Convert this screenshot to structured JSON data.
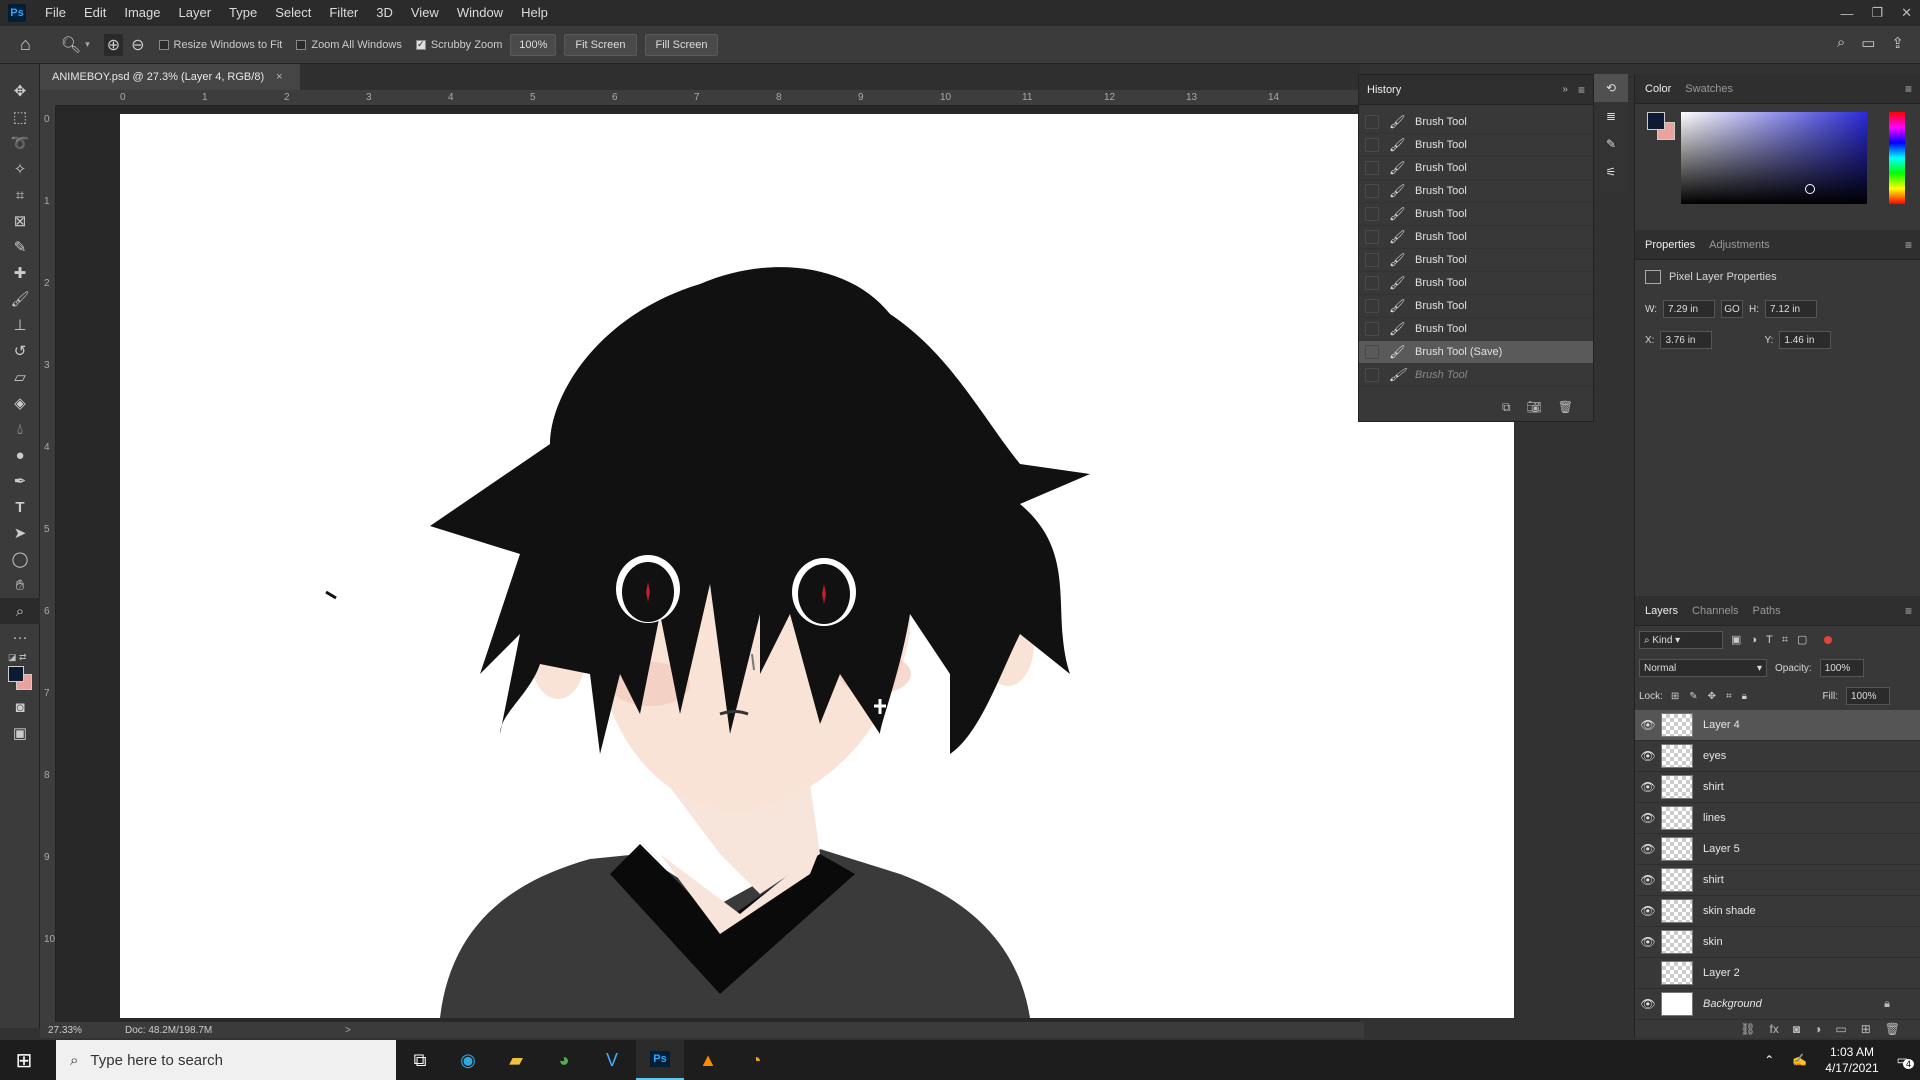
{
  "app": {
    "logo": "Ps",
    "menu": [
      "File",
      "Edit",
      "Image",
      "Layer",
      "Type",
      "Select",
      "Filter",
      "3D",
      "View",
      "Window",
      "Help"
    ],
    "window_controls": [
      "minimize-icon",
      "restore-icon",
      "close-icon"
    ]
  },
  "options_bar": {
    "resize_windows_label": "Resize Windows to Fit",
    "resize_windows_checked": false,
    "zoom_all_label": "Zoom All Windows",
    "zoom_all_checked": false,
    "scrubby_zoom_label": "Scrubby Zoom",
    "scrubby_zoom_checked": true,
    "zoom_value": "100%",
    "fit_screen": "Fit Screen",
    "fill_screen": "Fill Screen"
  },
  "document": {
    "tab_title": "ANIMEBOY.psd @ 27.3% (Layer 4, RGB/8)",
    "close": "×",
    "ruler_h": [
      "0",
      "1",
      "2",
      "3",
      "4",
      "5",
      "6",
      "7",
      "8",
      "9",
      "10",
      "11",
      "12",
      "13",
      "14"
    ],
    "ruler_v": [
      "0",
      "1",
      "2",
      "3",
      "4",
      "5",
      "6",
      "7",
      "8",
      "9",
      "10"
    ]
  },
  "status": {
    "zoom": "27.33%",
    "doc": "Doc: 48.2M/198.7M",
    "arrow": ">"
  },
  "history": {
    "title": "History",
    "items": [
      {
        "label": "Brush Tool",
        "state": "normal"
      },
      {
        "label": "Brush Tool",
        "state": "normal"
      },
      {
        "label": "Brush Tool",
        "state": "normal"
      },
      {
        "label": "Brush Tool",
        "state": "normal"
      },
      {
        "label": "Brush Tool",
        "state": "normal"
      },
      {
        "label": "Brush Tool",
        "state": "normal"
      },
      {
        "label": "Brush Tool",
        "state": "normal"
      },
      {
        "label": "Brush Tool",
        "state": "normal"
      },
      {
        "label": "Brush Tool",
        "state": "normal"
      },
      {
        "label": "Brush Tool",
        "state": "normal"
      },
      {
        "label": "Brush Tool (Save)",
        "state": "selected"
      },
      {
        "label": "Brush Tool",
        "state": "dimmed"
      }
    ]
  },
  "color_panel": {
    "tabs": [
      "Color",
      "Swatches"
    ],
    "foreground": "#0d1a33",
    "background": "#e8a49c",
    "hue_color": "#2a2ad8"
  },
  "properties": {
    "tabs": [
      "Properties",
      "Adjustments"
    ],
    "heading": "Pixel Layer Properties",
    "w_label": "W:",
    "w": "7.29 in",
    "link": "GO",
    "h_label": "H:",
    "h": "7.12 in",
    "x_label": "X:",
    "x": "3.76 in",
    "y_label": "Y:",
    "y": "1.46 in"
  },
  "layers_panel": {
    "tabs": [
      "Layers",
      "Channels",
      "Paths"
    ],
    "kind": "Kind",
    "blend_mode": "Normal",
    "opacity_label": "Opacity:",
    "opacity": "100%",
    "lock_label": "Lock:",
    "fill_label": "Fill:",
    "fill": "100%",
    "layers": [
      {
        "name": "Layer 4",
        "visible": true,
        "selected": true
      },
      {
        "name": "eyes",
        "visible": true,
        "selected": false
      },
      {
        "name": "shirt",
        "visible": true,
        "selected": false
      },
      {
        "name": "lines",
        "visible": true,
        "selected": false
      },
      {
        "name": "Layer 5",
        "visible": true,
        "selected": false
      },
      {
        "name": "shirt",
        "visible": true,
        "selected": false
      },
      {
        "name": "skin shade",
        "visible": true,
        "selected": false
      },
      {
        "name": "skin",
        "visible": true,
        "selected": false
      },
      {
        "name": "Layer 2",
        "visible": false,
        "selected": false
      },
      {
        "name": "Background",
        "visible": true,
        "selected": false,
        "locked": true
      }
    ]
  },
  "taskbar": {
    "search_placeholder": "Type here to search",
    "time": "1:03 AM",
    "date": "4/17/2021",
    "notif_count": "4"
  }
}
